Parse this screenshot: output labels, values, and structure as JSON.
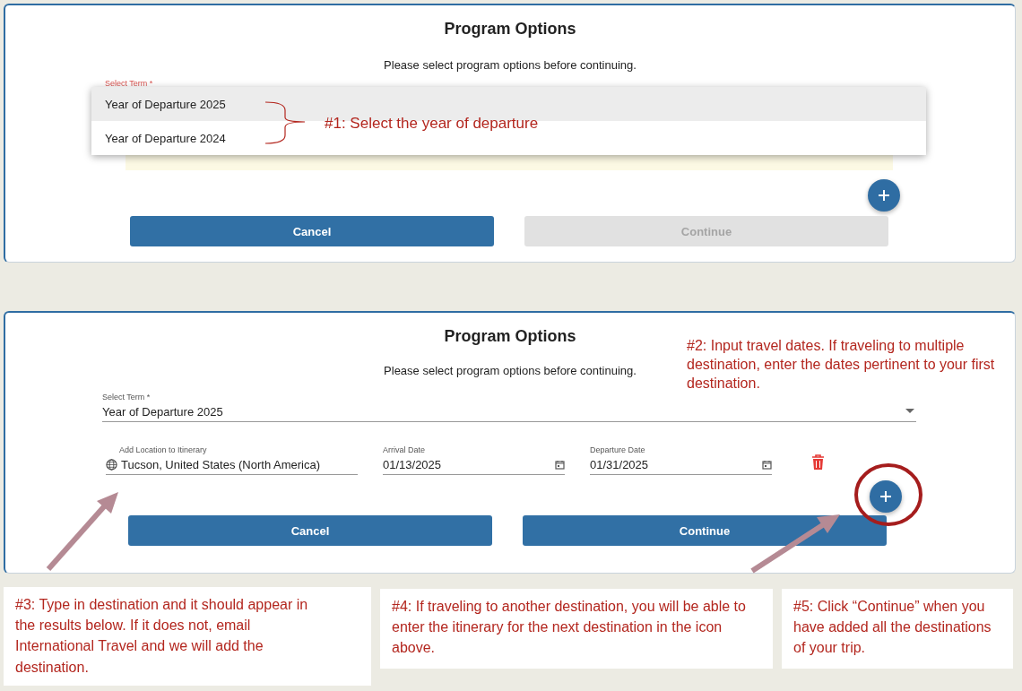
{
  "screen_1": {
    "title": "Program Options",
    "subtitle": "Please select program options before continuing.",
    "term_label": "Select Term *",
    "menu_options": [
      {
        "label": "Year of Departure 2025",
        "selected": true
      },
      {
        "label": "Year of Departure 2024",
        "selected": false
      }
    ],
    "buttons": [
      {
        "label": "Cancel",
        "disabled": false
      },
      {
        "label": "Continue",
        "disabled": true
      }
    ],
    "annotation": "#1: Select the year of departure"
  },
  "screen_2": {
    "title": "Program Options",
    "subtitle": "Please select program options before continuing.",
    "term": {
      "label": "Select Term *",
      "value": "Year of Departure 2025"
    },
    "fields": [
      {
        "kind": "location",
        "label": "Add Location to Itinerary",
        "value": "Tucson, United States (North America)"
      },
      {
        "kind": "date",
        "label": "Arrival Date",
        "value": "01/13/2025"
      },
      {
        "kind": "date",
        "label": "Departure Date",
        "value": "01/31/2025"
      }
    ],
    "buttons": [
      {
        "label": "Cancel",
        "disabled": false
      },
      {
        "label": "Continue",
        "disabled": false
      }
    ],
    "annotation": "#2: Input travel dates. If traveling to multiple destination, enter the dates pertinent to your first destination."
  },
  "notes": [
    "#3: Type in destination and it should appear in the results below. If it does not, email International Travel and we will add the destination.",
    "#4: If traveling to another destination, you will be able to enter the itinerary for the next destination in the icon above.",
    "#5: Click “Continue” when you have added all the destinations of your trip."
  ]
}
